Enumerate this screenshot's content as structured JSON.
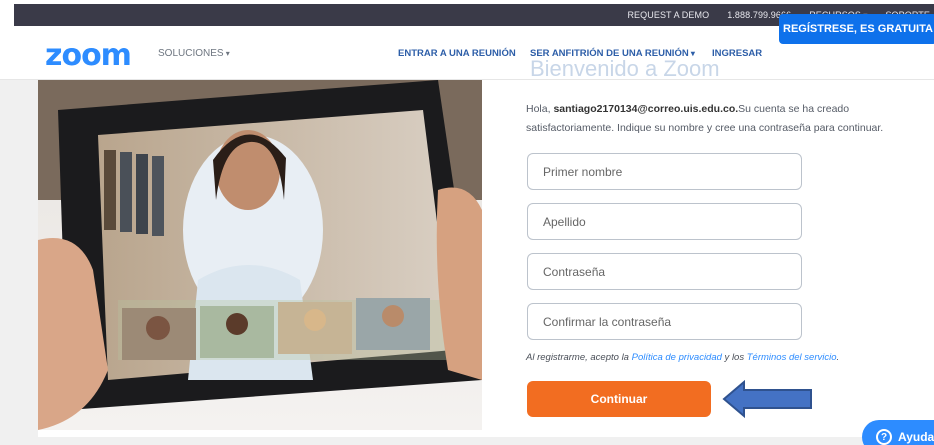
{
  "topbar": {
    "request_demo": "REQUEST A DEMO",
    "phone": "1.888.799.9666",
    "resources": "RECURSOS",
    "support": "SOPORTE"
  },
  "navbar": {
    "logo": "zoom",
    "solutions": "SOLUCIONES",
    "join": "ENTRAR A UNA REUNIÓN",
    "host": "SER ANFITRIÓN DE UNA REUNIÓN",
    "login": "INGRESAR",
    "signup": "REGÍSTRESE, ES GRATUITA"
  },
  "form": {
    "ghost_title": "Bienvenido a Zoom",
    "greeting_prefix": "Hola, ",
    "email": "santiago2170134@correo.uis.edu.co.",
    "greeting_suffix": "Su cuenta se ha creado satisfactoriamente. Indique su nombre y cree una contraseña para continuar.",
    "first_name_placeholder": "Primer nombre",
    "last_name_placeholder": "Apellido",
    "password_placeholder": "Contraseña",
    "confirm_placeholder": "Confirmar la contraseña",
    "terms_prefix": "Al registrarme, acepto la ",
    "privacy_link": "Política de privacidad",
    "terms_and": " y los ",
    "terms_link": "Términos del servicio",
    "terms_suffix": ".",
    "continue": "Continuar"
  },
  "help": {
    "label": "Ayuda"
  },
  "colors": {
    "brand_blue": "#2d8cff",
    "signup_blue": "#0e71eb",
    "continue_orange": "#f26d21",
    "arrow_blue": "#4472c4"
  }
}
